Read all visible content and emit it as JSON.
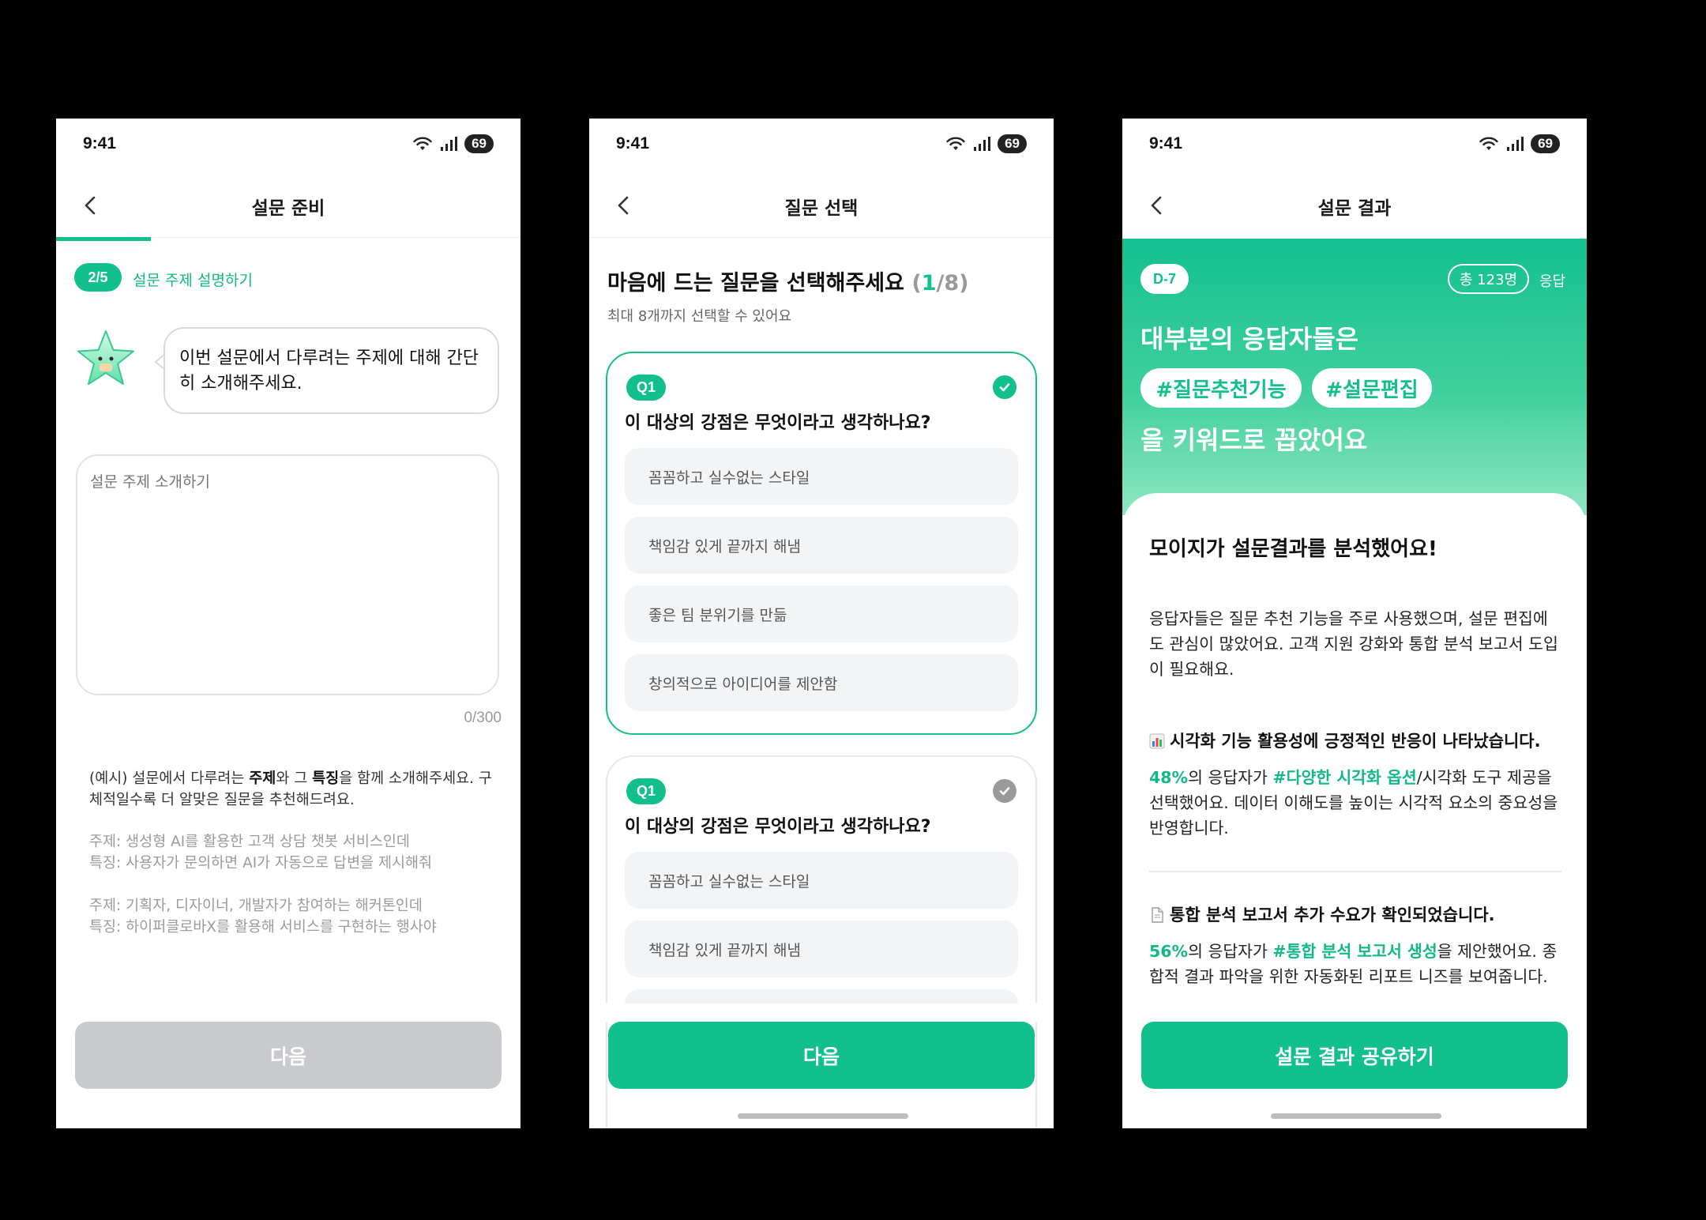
{
  "status": {
    "time": "9:41",
    "battery": "69"
  },
  "screen1": {
    "title": "설문 준비",
    "step": "2/5",
    "step_label": "설문 주제 설명하기",
    "bubble": "이번 설문에서 다루려는 주제에 대해 간단히 소개해주세요.",
    "input_placeholder": "설문 주제 소개하기",
    "counter": "0/300",
    "example_prefix": "(예시) 설문에서 다루려는 ",
    "example_bold1": "주제",
    "example_mid": "와 그 ",
    "example_bold2": "특징",
    "example_suffix": "을 함께 소개해주세요. 구체적일수록 더 알맞은 질문을 추천해드려요.",
    "samples": [
      {
        "topic": "주제: 생성형 AI를 활용한 고객 상담 챗봇 서비스인데",
        "feature": "특징: 사용자가 문의하면 AI가 자동으로 답변을 제시해줘"
      },
      {
        "topic": "주제: 기획자, 디자이너, 개발자가 참여하는 해커톤인데",
        "feature": "특징: 하이퍼클로바X를 활용해 서비스를 구현하는 행사야"
      }
    ],
    "next_label": "다음"
  },
  "screen2": {
    "title": "질문 선택",
    "heading": "마음에 드는 질문을 선택해주세요",
    "count_open": "(",
    "count_now": "1",
    "count_rest": "/8)",
    "sub": "최대 8개까지 선택할 수 있어요",
    "questions": [
      {
        "tag": "Q1",
        "text": "이 대상의 강점은 무엇이라고 생각하나요?",
        "selected": true,
        "options": [
          "꼼꼼하고 실수없는 스타일",
          "책임감 있게 끝까지 해냄",
          "좋은 팀 분위기를 만듦",
          "창의적으로 아이디어를 제안함"
        ]
      },
      {
        "tag": "Q1",
        "text": "이 대상의 강점은 무엇이라고 생각하나요?",
        "selected": false,
        "options": [
          "꼼꼼하고 실수없는 스타일",
          "책임감 있게 끝까지 해냄",
          ""
        ]
      }
    ],
    "next_label": "다음"
  },
  "screen3": {
    "title": "설문 결과",
    "dday": "D-7",
    "total": "총 123명",
    "resp_label": "응답",
    "hero_line1": "대부분의 응답자들은",
    "tags": [
      "#질문추천기능",
      "#설문편집"
    ],
    "hero_line3": "을 키워드로 꼽았어요",
    "sheet_title": "모이지가 설문결과를 분석했어요!",
    "summary": "응답자들은 질문 추천 기능을 주로 사용했으며, 설문 편집에도 관심이 많았어요. 고객 지원 강화와 통합 분석 보고서 도입이 필요해요.",
    "section1": {
      "heading": "시각화 기능 활용성에 긍정적인 반응이 나타났습니다.",
      "pct": "48%",
      "text_a": "의 응답자가 ",
      "tag": "#다양한 시각화 옵션",
      "text_b": "/시각화 도구 제공을 선택했어요. 데이터 이해도를 높이는 시각적 요소의 중요성을 반영합니다."
    },
    "section2": {
      "heading": "통합 분석 보고서 추가 수요가 확인되었습니다.",
      "pct": "56%",
      "text_a": "의 응답자가 ",
      "tag": "#통합 분석 보고서 생성",
      "text_b": "을 제안했어요. 종합적 결과 파악을 위한 자동화된 리포트 니즈를 보여줍니다."
    },
    "share_label": "설문 결과 공유하기"
  },
  "colors": {
    "accent": "#12c08e",
    "disabled": "#c9cacd"
  }
}
